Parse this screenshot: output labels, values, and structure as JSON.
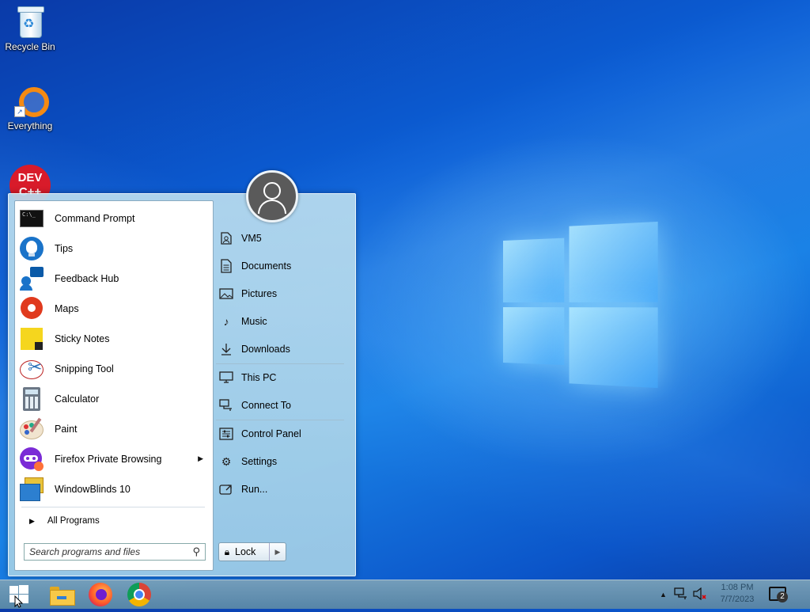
{
  "desktop": {
    "icons": [
      {
        "label": "Recycle Bin",
        "icon": "recycle-bin-icon"
      },
      {
        "label": "Everything",
        "icon": "everything-search-icon"
      },
      {
        "label": "DEV C++",
        "icon": "dev-cpp-icon"
      }
    ]
  },
  "start_menu": {
    "programs": [
      {
        "label": "Command Prompt",
        "icon": "command-prompt-icon"
      },
      {
        "label": "Tips",
        "icon": "tips-icon"
      },
      {
        "label": "Feedback Hub",
        "icon": "feedback-hub-icon"
      },
      {
        "label": "Maps",
        "icon": "maps-icon"
      },
      {
        "label": "Sticky Notes",
        "icon": "sticky-notes-icon"
      },
      {
        "label": "Snipping Tool",
        "icon": "snipping-tool-icon"
      },
      {
        "label": "Calculator",
        "icon": "calculator-icon"
      },
      {
        "label": "Paint",
        "icon": "paint-icon"
      },
      {
        "label": "Firefox Private Browsing",
        "icon": "firefox-private-icon",
        "submenu": true
      },
      {
        "label": "WindowBlinds 10",
        "icon": "windowblinds-icon"
      }
    ],
    "all_programs": "All Programs",
    "search_placeholder": "Search programs and files",
    "right_items": [
      {
        "label": "VM5",
        "icon": "user-folder-icon"
      },
      {
        "label": "Documents",
        "icon": "documents-icon"
      },
      {
        "label": "Pictures",
        "icon": "pictures-icon"
      },
      {
        "label": "Music",
        "icon": "music-icon"
      },
      {
        "label": "Downloads",
        "icon": "downloads-icon"
      },
      {
        "label": "This PC",
        "icon": "this-pc-icon"
      },
      {
        "label": "Connect To",
        "icon": "network-icon"
      },
      {
        "label": "Control Panel",
        "icon": "control-panel-icon"
      },
      {
        "label": "Settings",
        "icon": "gear-icon"
      },
      {
        "label": "Run...",
        "icon": "run-icon"
      }
    ],
    "lock_label": "Lock"
  },
  "taskbar": {
    "pinned": [
      {
        "name": "start-button",
        "icon": "windows-icon"
      },
      {
        "name": "file-explorer",
        "icon": "folder-icon"
      },
      {
        "name": "firefox",
        "icon": "firefox-icon"
      },
      {
        "name": "chrome",
        "icon": "chrome-icon"
      }
    ],
    "time": "1:08 PM",
    "date": "7/7/2023",
    "notification_count": "2"
  }
}
